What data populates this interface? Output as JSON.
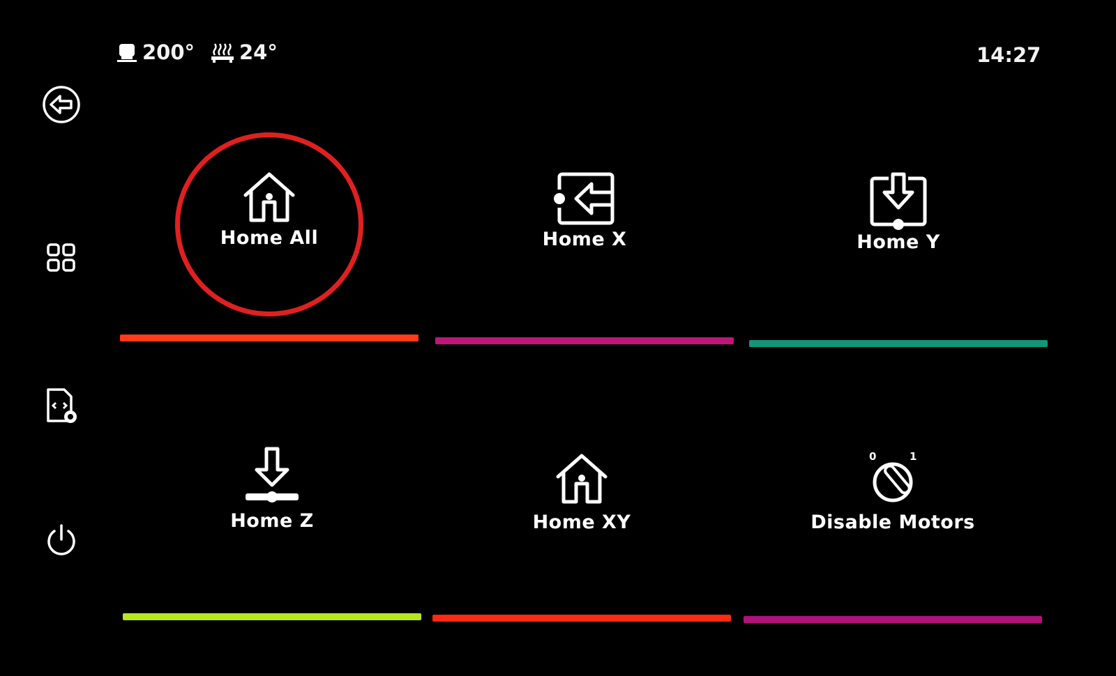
{
  "status": {
    "hotend": {
      "icon": "hotend-icon",
      "temp": "200°"
    },
    "bed": {
      "icon": "heated-bed-icon",
      "temp": "24°"
    },
    "clock": "14:27"
  },
  "sidebar": {
    "items": [
      {
        "name": "back",
        "icon": "back-arrow-icon"
      },
      {
        "name": "menu",
        "icon": "grid-menu-icon"
      },
      {
        "name": "files",
        "icon": "file-print-icon"
      },
      {
        "name": "power",
        "icon": "power-icon"
      }
    ]
  },
  "tiles": [
    {
      "label": "Home All",
      "icon": "home-all-icon",
      "color": "#ff3b1a"
    },
    {
      "label": "Home X",
      "icon": "home-x-icon",
      "color": "#c0157a"
    },
    {
      "label": "Home Y",
      "icon": "home-y-icon",
      "color": "#12957a"
    },
    {
      "label": "Home Z",
      "icon": "home-z-icon",
      "color": "#b8e61e"
    },
    {
      "label": "Home XY",
      "icon": "home-xy-icon",
      "color": "#ff2a14"
    },
    {
      "label": "Disable Motors",
      "icon": "disable-motors-icon",
      "color": "#b0127a",
      "switch_off": "0",
      "switch_on": "1"
    }
  ],
  "annotation": {
    "color": "#e02020",
    "target": "Home All"
  }
}
